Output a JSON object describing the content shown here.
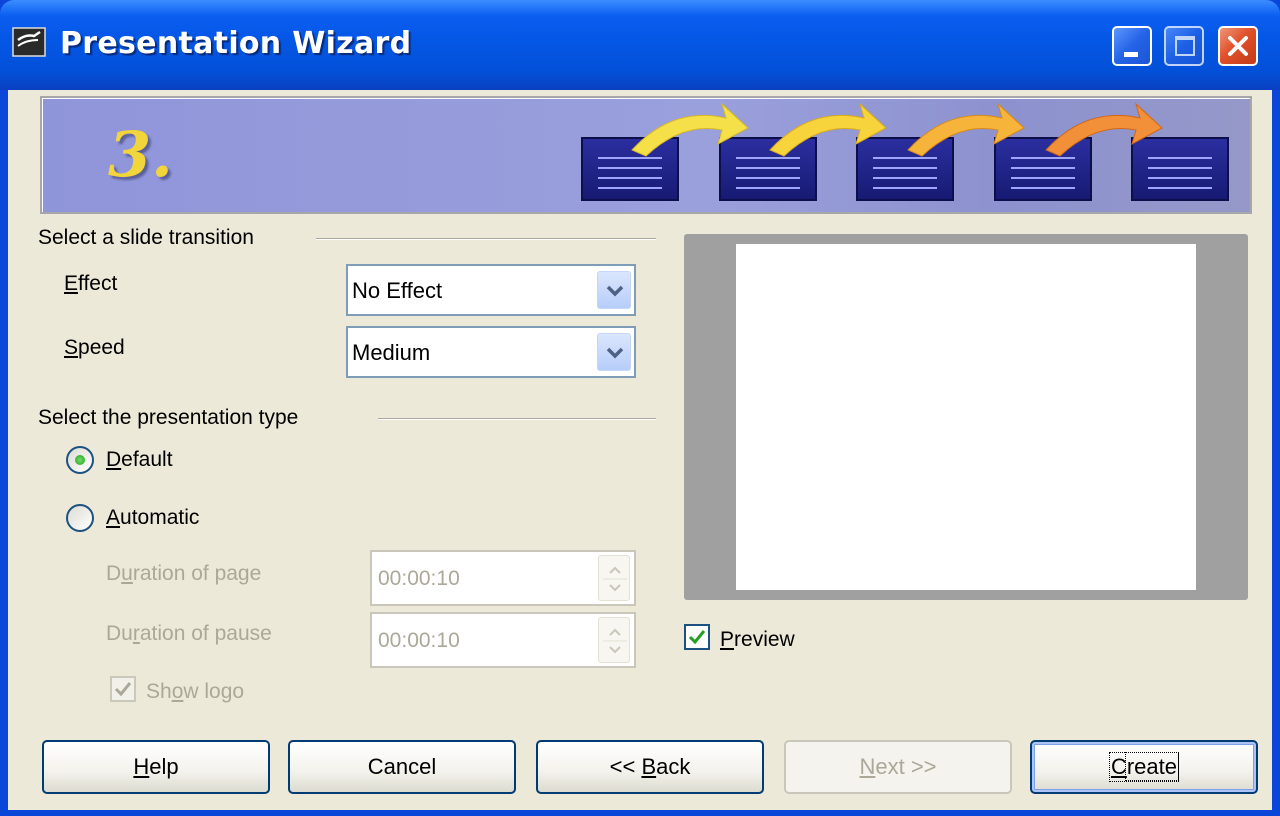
{
  "window": {
    "title": "Presentation Wizard",
    "colors": {
      "titlebar": "#0350d8",
      "accent": "#3b8dff",
      "close": "#e0502a"
    }
  },
  "banner": {
    "step": "3."
  },
  "transition_group": {
    "label": "Select a slide transition",
    "effect_label_mnemonic": "E",
    "effect_label_rest": "ffect",
    "effect_value": "No Effect",
    "speed_label_mnemonic": "S",
    "speed_label_rest": "peed",
    "speed_value": "Medium"
  },
  "type_group": {
    "label": "Select the presentation type",
    "default_mnemonic": "D",
    "default_rest": "efault",
    "default_selected": true,
    "automatic_mnemonic": "A",
    "automatic_rest": "utomatic",
    "duration_page_pre": "D",
    "duration_page_mnemonic": "u",
    "duration_page_rest": "ration of page",
    "duration_page_value": "00:00:10",
    "duration_pause_pre": "Du",
    "duration_pause_mnemonic": "r",
    "duration_pause_rest": "ation of pause",
    "duration_pause_value": "00:00:10",
    "show_logo_pre": "Sh",
    "show_logo_mnemonic": "o",
    "show_logo_rest": "w logo",
    "show_logo_checked": true
  },
  "preview": {
    "mnemonic": "P",
    "rest": "review",
    "checked": true
  },
  "buttons": {
    "help_mnemonic": "H",
    "help_rest": "elp",
    "cancel": "Cancel",
    "back_pre": "<< ",
    "back_mnemonic": "B",
    "back_rest": "ack",
    "next_mnemonic": "N",
    "next_rest": "ext >>",
    "create_mnemonic": "C",
    "create_rest": "reate"
  }
}
